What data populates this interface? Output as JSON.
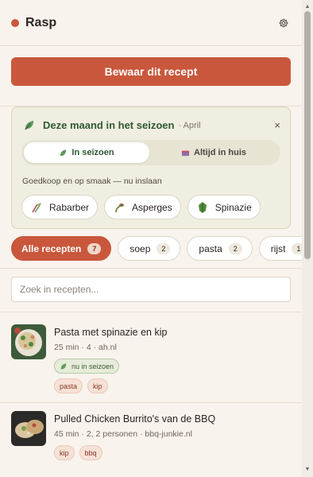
{
  "header": {
    "brand": "Rasp",
    "settings_icon": "gear-icon"
  },
  "save": {
    "label": "Bewaar dit recept"
  },
  "season": {
    "title": "Deze maand in het seizoen",
    "month": "· April",
    "close": "×",
    "tabs": [
      {
        "label": "In seizoen",
        "icon": "sprout-icon",
        "active": true
      },
      {
        "label": "Altijd in huis",
        "icon": "box-icon",
        "active": false
      }
    ],
    "note": "Goedkoop en op smaak — nu inslaan",
    "items": [
      {
        "label": "Rabarber",
        "icon": "rhubarb-icon"
      },
      {
        "label": "Asperges",
        "icon": "asparagus-icon"
      },
      {
        "label": "Spinazie",
        "icon": "spinach-icon"
      }
    ]
  },
  "filters": [
    {
      "label": "Alle recepten",
      "count": "7",
      "active": true
    },
    {
      "label": "soep",
      "count": "2",
      "active": false
    },
    {
      "label": "pasta",
      "count": "2",
      "active": false
    },
    {
      "label": "rijst",
      "count": "1",
      "active": false
    }
  ],
  "search": {
    "placeholder": "Zoek in recepten..."
  },
  "recipes": [
    {
      "title": "Pasta met spinazie en kip",
      "meta": "25 min · 4 · ah.nl",
      "season_tag": "nu in seizoen",
      "tags": [
        "pasta",
        "kip"
      ]
    },
    {
      "title": "Pulled Chicken Burrito's van de BBQ",
      "meta": "45 min · 2, 2 personen · bbq-junkie.nl",
      "tags": [
        "kip",
        "bbq"
      ]
    }
  ],
  "colors": {
    "accent": "#c9573c",
    "season_green": "#2f5a34",
    "background": "#f8f3ec"
  }
}
